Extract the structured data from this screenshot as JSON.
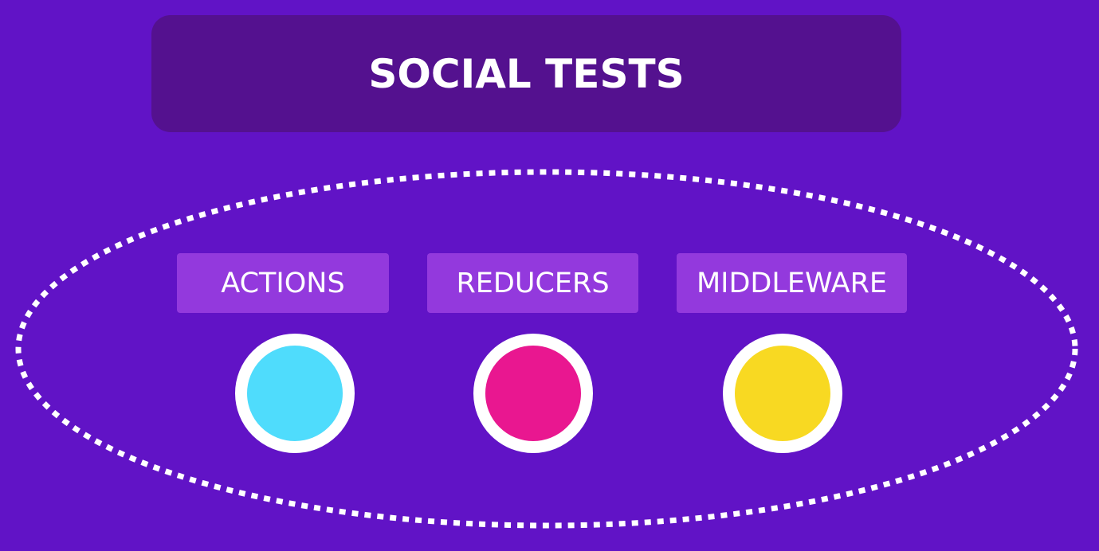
{
  "title": "SOCIAL TESTS",
  "colors": {
    "background": "#6113c6",
    "title_box": "#54118f",
    "label_box": "#9339dd",
    "dotted_outline": "#ffffff"
  },
  "groups": [
    {
      "label": "ACTIONS",
      "dot_color": "#4fdcfc"
    },
    {
      "label": "REDUCERS",
      "dot_color": "#e91790"
    },
    {
      "label": "MIDDLEWARE",
      "dot_color": "#f8d922"
    }
  ]
}
